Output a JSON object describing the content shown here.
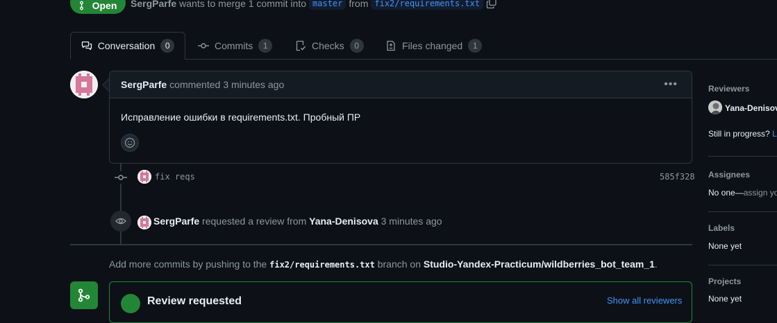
{
  "header": {
    "state": "Open",
    "author": "SergParfe",
    "merge_text": "wants to merge 1 commit into",
    "base_branch": "master",
    "from_text": "from",
    "head_branch": "fix2/requirements.txt"
  },
  "tabs": [
    {
      "label": "Conversation",
      "count": "0"
    },
    {
      "label": "Commits",
      "count": "1"
    },
    {
      "label": "Checks",
      "count": "0"
    },
    {
      "label": "Files changed",
      "count": "1"
    }
  ],
  "comment": {
    "author": "SergParfe",
    "action": "commented",
    "time": "3 minutes ago",
    "body": "Исправление ошибки в requirements.txt. Пробный ПР"
  },
  "commit": {
    "message": "fix reqs",
    "sha": "585f328"
  },
  "review_event": {
    "actor": "SergParfe",
    "text": "requested a review from",
    "reviewer": "Yana-Denisova",
    "time": "3 minutes ago"
  },
  "push_hint": {
    "prefix": "Add more commits by pushing to the",
    "branch": "fix2/requirements.txt",
    "middle": "branch on",
    "repo": "Studio-Yandex-Practicum/wildberries_bot_team_1",
    "suffix": "."
  },
  "merge_box": {
    "title": "Review requested",
    "show_all": "Show all reviewers"
  },
  "sidebar": {
    "reviewers_heading": "Reviewers",
    "reviewer_name": "Yana-Denisova",
    "still_in_progress": "Still in progress?",
    "learn_link": "Le",
    "assignees_heading": "Assignees",
    "assignees_value": "No one—",
    "assign_yourself": "assign yo",
    "labels_heading": "Labels",
    "labels_value": "None yet",
    "projects_heading": "Projects",
    "projects_value": "None yet"
  },
  "colors": {
    "background": "#0d1117",
    "open_green": "#238636",
    "link_blue": "#4493f8",
    "border": "#30363d"
  }
}
